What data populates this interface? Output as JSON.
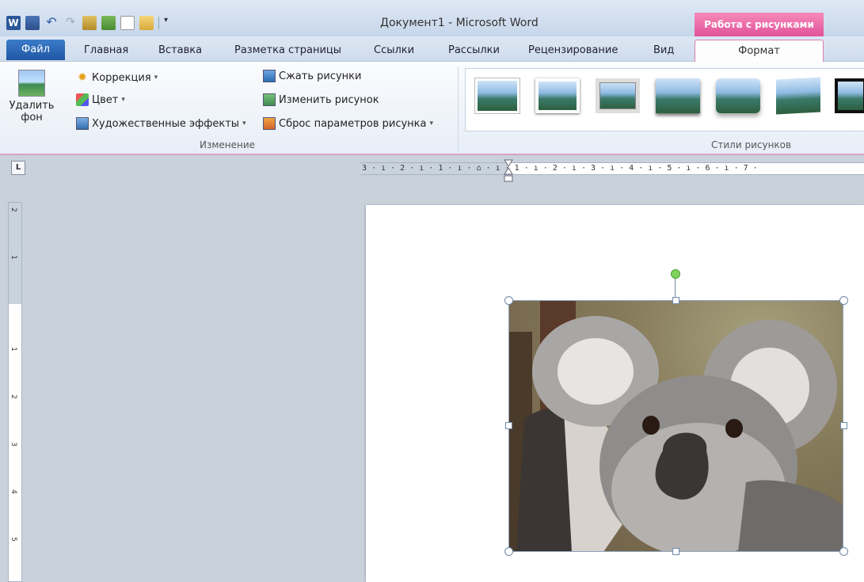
{
  "titlebar": {
    "title": "Документ1 - Microsoft Word",
    "context_group": "Работа с рисунками",
    "word_logo": "W"
  },
  "tabs": [
    {
      "label": "Файл"
    },
    {
      "label": "Главная"
    },
    {
      "label": "Вставка"
    },
    {
      "label": "Разметка страницы"
    },
    {
      "label": "Ссылки"
    },
    {
      "label": "Рассылки"
    },
    {
      "label": "Рецензирование"
    },
    {
      "label": "Вид"
    },
    {
      "label": "Формат"
    }
  ],
  "ribbon": {
    "remove_bg": {
      "line1": "Удалить",
      "line2": "фон"
    },
    "correction": "Коррекция",
    "color": "Цвет",
    "artistic": "Художественные эффекты",
    "compress": "Сжать рисунки",
    "change": "Изменить рисунок",
    "reset": "Сброс параметров рисунка",
    "group_change": "Изменение",
    "group_styles": "Стили рисунков"
  },
  "ruler": {
    "corner": "L",
    "horizontal": "3 · ı · 2 · ı · 1 · ı · ⌂ · ı · 1 · ı · 2 · ı · 3 · ı · 4 · ı · 5 · ı · 6 · ı · 7 ·",
    "vertical_numbers": [
      "2",
      "1",
      "1",
      "2",
      "3",
      "4",
      "5"
    ]
  },
  "colors": {
    "context_pink": "#e2539a",
    "file_blue": "#1f57a4",
    "accent_border": "#d9a3c3"
  }
}
